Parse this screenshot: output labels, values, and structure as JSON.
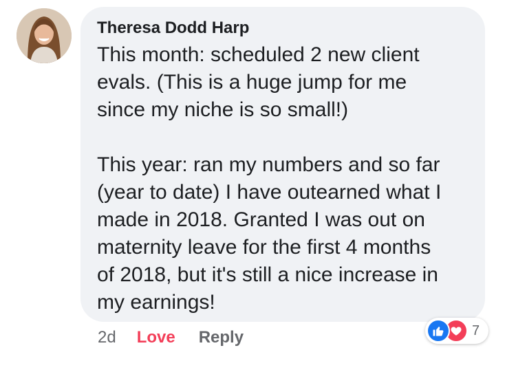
{
  "comment": {
    "author": "Theresa Dodd Harp",
    "paragraphs": [
      "This month: scheduled 2 new client\nevals. (This is a huge jump for me\nsince my niche is so small!)",
      "This year: ran my numbers and so far\n(year to date) I have outearned what I\nmade in 2018. Granted I was out on\nmaternity leave for the first 4 months\nof 2018, but it's still a nice increase in\nmy earnings!"
    ]
  },
  "actions": {
    "time": "2d",
    "love_label": "Love",
    "reply_label": "Reply"
  },
  "reactions": {
    "icons": [
      "like-icon",
      "heart-icon"
    ],
    "count": "7",
    "colors": {
      "like": "#1877f2",
      "love": "#f33e58"
    }
  }
}
